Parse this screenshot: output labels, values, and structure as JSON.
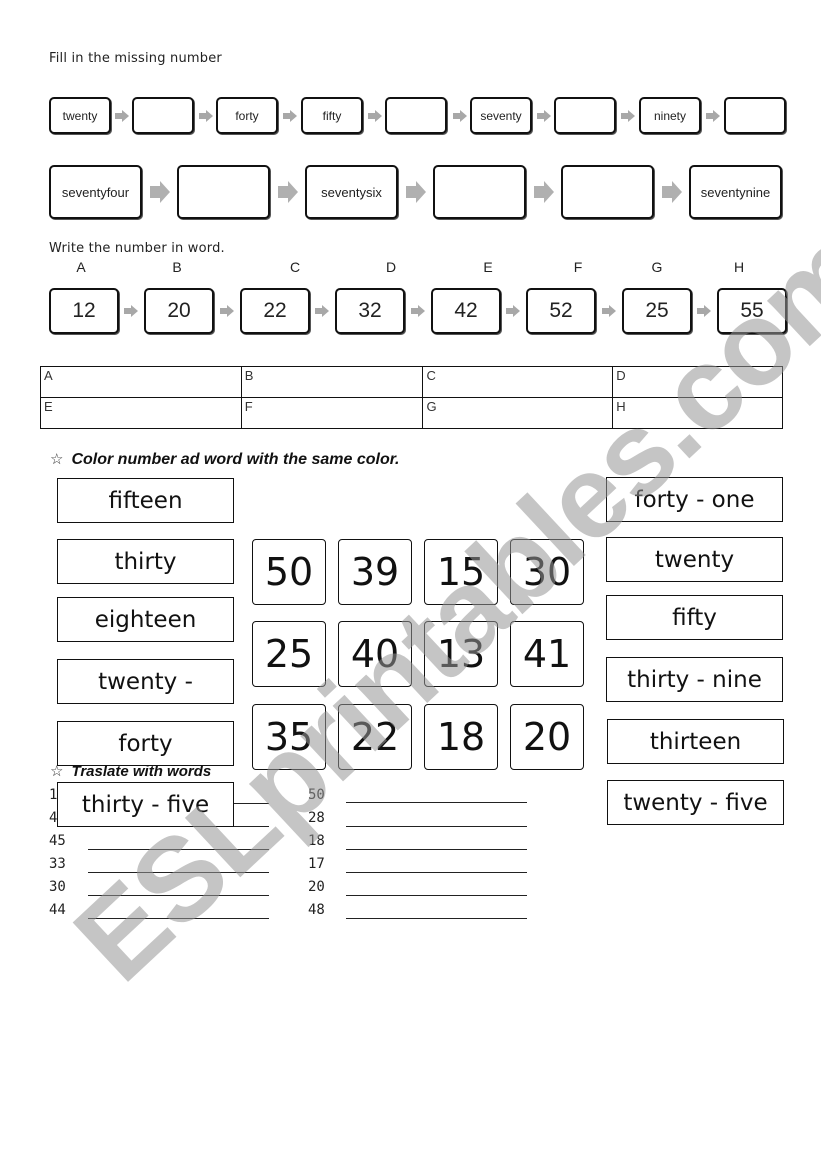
{
  "section1": {
    "instruction": "Fill in the missing number",
    "row1": [
      "twenty",
      "",
      "forty",
      "fifty",
      "",
      "seventy",
      "",
      "ninety",
      ""
    ],
    "row2": [
      "seventyfour",
      "",
      "seventysix",
      "",
      "",
      "seventynine"
    ]
  },
  "section2": {
    "instruction": "Write the number in word.",
    "items": [
      {
        "letter": "A",
        "number": "12"
      },
      {
        "letter": "B",
        "number": "20"
      },
      {
        "letter": "C",
        "number": "22"
      },
      {
        "letter": "D",
        "number": "32"
      },
      {
        "letter": "E",
        "number": "42"
      },
      {
        "letter": "F",
        "number": "52"
      },
      {
        "letter": "G",
        "number": "25"
      },
      {
        "letter": "H",
        "number": "55"
      }
    ],
    "answer_table": [
      [
        "A",
        "B",
        "C",
        "D"
      ],
      [
        "E",
        "F",
        "G",
        "H"
      ]
    ]
  },
  "section3": {
    "star_icon": "☆",
    "title": "Color number ad word with the same color.",
    "left_words": [
      "fifteen",
      "thirty",
      "eighteen",
      "twenty -",
      "forty",
      "thirty - five"
    ],
    "numbers": [
      [
        "50",
        "39",
        "15",
        "30"
      ],
      [
        "25",
        "40",
        "13",
        "41"
      ],
      [
        "35",
        "22",
        "18",
        "20"
      ]
    ],
    "right_words": [
      "forty - one",
      "twenty",
      "fifty",
      "thirty - nine",
      "thirteen",
      "twenty - five"
    ]
  },
  "section4": {
    "star_icon": "☆",
    "title": "Traslate with words",
    "left_numbers": [
      "1",
      "4",
      "45",
      "33",
      "30",
      "44"
    ],
    "right_numbers": [
      "50",
      "28",
      "18",
      "17",
      "20",
      "48"
    ]
  },
  "watermark": "ESLprintables.com"
}
